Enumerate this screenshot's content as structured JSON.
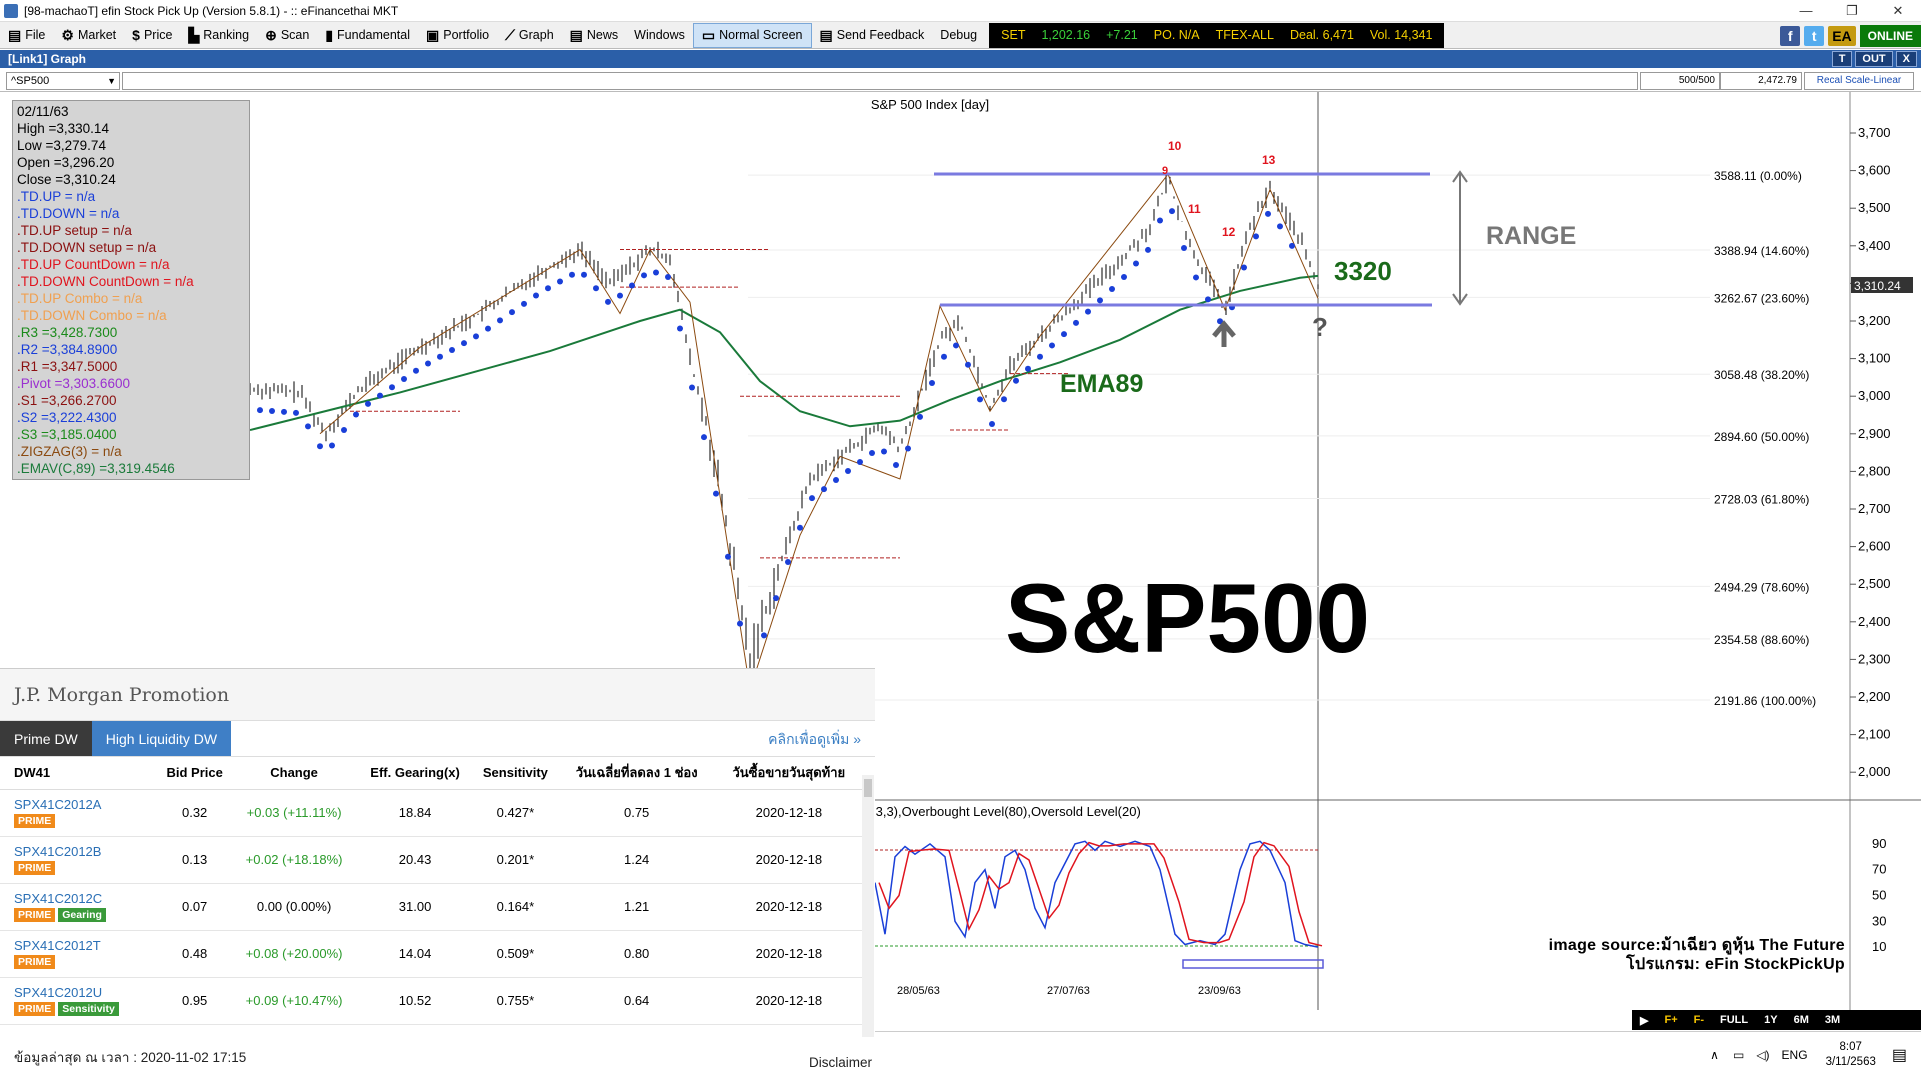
{
  "window": {
    "title": "[98-machaoT] efin Stock Pick Up (Version 5.8.1) - :: eFinancethai MKT",
    "controls": [
      "—",
      "❐",
      "✕"
    ]
  },
  "menu": [
    {
      "label": "File",
      "icon": "▤"
    },
    {
      "label": "Market",
      "icon": "⚙"
    },
    {
      "label": "Price",
      "icon": "$"
    },
    {
      "label": "Ranking",
      "icon": "▙"
    },
    {
      "label": "Scan",
      "icon": "⊕"
    },
    {
      "label": "Fundamental",
      "icon": "▮"
    },
    {
      "label": "Portfolio",
      "icon": "▣"
    },
    {
      "label": "Graph",
      "icon": "⟋"
    },
    {
      "label": "News",
      "icon": "▤"
    },
    {
      "label": "Windows",
      "icon": ""
    },
    {
      "label": "Normal Screen",
      "icon": "▭"
    },
    {
      "label": "Send Feedback",
      "icon": "▤"
    },
    {
      "label": "Debug",
      "icon": ""
    }
  ],
  "ticker": {
    "set": "SET",
    "set_value": "1,202.16",
    "set_change": "+7.21",
    "po": "PO. N/A",
    "tfex": "TFEX-ALL",
    "deal": "Deal. 6,471",
    "vol": "Vol. 14,341"
  },
  "social": {
    "ea": "EA",
    "online": "ONLINE"
  },
  "panel": {
    "title": "[Link1] Graph",
    "btn_t": "T",
    "btn_out": "OUT",
    "btn_x": "X"
  },
  "symbol": {
    "value": "^SP500",
    "ratio": "500/500",
    "last": "2,472.79",
    "recal": "Recal Scale-Linear"
  },
  "chart_title": "S&P 500 Index [day]",
  "info": [
    {
      "text": "02/11/63",
      "color": "#000000"
    },
    {
      "text": "High  =3,330.14",
      "color": "#000000"
    },
    {
      "text": "Low  =3,279.74",
      "color": "#000000"
    },
    {
      "text": "Open  =3,296.20",
      "color": "#000000"
    },
    {
      "text": "Close  =3,310.24",
      "color": "#000000"
    },
    {
      "text": ".TD.UP   = n/a",
      "color": "#1a3fd8"
    },
    {
      "text": ".TD.DOWN   = n/a",
      "color": "#1a3fd8"
    },
    {
      "text": ".TD.UP setup   = n/a",
      "color": "#8b1010"
    },
    {
      "text": ".TD.DOWN setup   = n/a",
      "color": "#8b1010"
    },
    {
      "text": ".TD.UP CountDown   = n/a",
      "color": "#e0141e"
    },
    {
      "text": ".TD.DOWN CountDown   = n/a",
      "color": "#e0141e"
    },
    {
      "text": ".TD.UP Combo   = n/a",
      "color": "#f0a050"
    },
    {
      "text": ".TD.DOWN Combo   = n/a",
      "color": "#f0a050"
    },
    {
      "text": ".R3   =3,428.7300",
      "color": "#1a8a1a"
    },
    {
      "text": ".R2   =3,384.8900",
      "color": "#1a3fd8"
    },
    {
      "text": ".R1   =3,347.5000",
      "color": "#8b1010"
    },
    {
      "text": ".Pivot   =3,303.6600",
      "color": "#9a2fd0"
    },
    {
      "text": ".S1   =3,266.2700",
      "color": "#8b1010"
    },
    {
      "text": ".S2   =3,222.4300",
      "color": "#1a3fd8"
    },
    {
      "text": ".S3   =3,185.0400",
      "color": "#1a8a1a"
    },
    {
      "text": ".ZIGZAG(3)   = n/a",
      "color": "#8b4a10"
    },
    {
      "text": ".EMAV(C,89)   =3,319.4546",
      "color": "#1a7a3a"
    }
  ],
  "price_axis": [
    "3,700",
    "3,600",
    "3,500",
    "3,400",
    "3,300",
    "3,200",
    "3,100",
    "3,000",
    "2,900",
    "2,800",
    "2,700",
    "2,600",
    "2,500",
    "2,400",
    "2,300",
    "2,200",
    "2,100",
    "2,000"
  ],
  "price_current": "3,310.24",
  "fib_levels": [
    "3588.11 (0.00%)",
    "3388.94 (14.60%)",
    "3262.67 (23.60%)",
    "3058.48 (38.20%)",
    "2894.60 (50.00%)",
    "2728.03 (61.80%)",
    "2494.29 (78.60%)",
    "2354.58 (88.60%)",
    "2191.86 (100.00%)"
  ],
  "annotations": {
    "range": "RANGE",
    "ema_value": "3320",
    "ema_label": "EMA89",
    "big_title": "S&P500",
    "question": "?"
  },
  "td_labels": {
    "n10": "10",
    "n9": "9",
    "n13a": "13",
    "n11": "11",
    "n12": "12"
  },
  "stoch": {
    "title": ",3,3),Overbought Level(80),Oversold Level(20)",
    "axis": [
      "90",
      "70",
      "50",
      "30",
      "10"
    ],
    "dates": [
      "28/05/63",
      "27/07/63",
      "23/09/63"
    ]
  },
  "credit": {
    "line1": "image source:ม้าเฉียว ดูหุ้น The Future",
    "line2": "โปรแกรม: eFin StockPickUp"
  },
  "promo": {
    "title": "J.P. Morgan Promotion",
    "tabs": [
      "Prime DW",
      "High Liquidity DW"
    ],
    "more": "คลิกเพื่อดูเพิ่ม »",
    "headers": [
      "DW41",
      "Bid Price",
      "Change",
      "Eff. Gearing(x)",
      "Sensitivity",
      "วันเฉลี่ยที่ลดลง 1 ช่อง",
      "วันซื้อขายวันสุดท้าย"
    ],
    "rows": [
      {
        "name": "SPX41C2012A",
        "tags": [
          "PRIME"
        ],
        "bid": "0.32",
        "change": "+0.03 (+11.11%)",
        "gearing": "18.84",
        "sens": "0.427*",
        "days": "0.75",
        "last": "2020-12-18"
      },
      {
        "name": "SPX41C2012B",
        "tags": [
          "PRIME"
        ],
        "bid": "0.13",
        "change": "+0.02 (+18.18%)",
        "gearing": "20.43",
        "sens": "0.201*",
        "days": "1.24",
        "last": "2020-12-18"
      },
      {
        "name": "SPX41C2012C",
        "tags": [
          "PRIME",
          "Gearing"
        ],
        "bid": "0.07",
        "change": "0.00 (0.00%)",
        "gearing": "31.00",
        "sens": "0.164*",
        "days": "1.21",
        "last": "2020-12-18"
      },
      {
        "name": "SPX41C2012T",
        "tags": [
          "PRIME"
        ],
        "bid": "0.48",
        "change": "+0.08 (+20.00%)",
        "gearing": "14.04",
        "sens": "0.509*",
        "days": "0.80",
        "last": "2020-12-18"
      },
      {
        "name": "SPX41C2012U",
        "tags": [
          "PRIME",
          "Sensitivity"
        ],
        "bid": "0.95",
        "change": "+0.09 (+10.47%)",
        "gearing": "10.52",
        "sens": "0.755*",
        "days": "0.64",
        "last": "2020-12-18"
      }
    ],
    "footer": "ข้อมูลล่าสุด ณ เวลา : 2020-11-02 17:15",
    "disclaimer": "Disclaimer"
  },
  "bottombar": [
    "F+",
    "F-",
    "FULL",
    "1Y",
    "6M",
    "3M"
  ],
  "taskbar": {
    "lang": "ENG",
    "time": "8:07",
    "date": "3/11/2563"
  },
  "colors": {
    "menu_selected": "#cfe3f7",
    "panel_head": "#2b5fa8",
    "tab_active": "#3a3a3a",
    "tab_inactive": "#3f7fc6",
    "range_line": "#7a7ae0",
    "ema": "#1a7a3a",
    "annotation_green": "#1a6a1a"
  }
}
